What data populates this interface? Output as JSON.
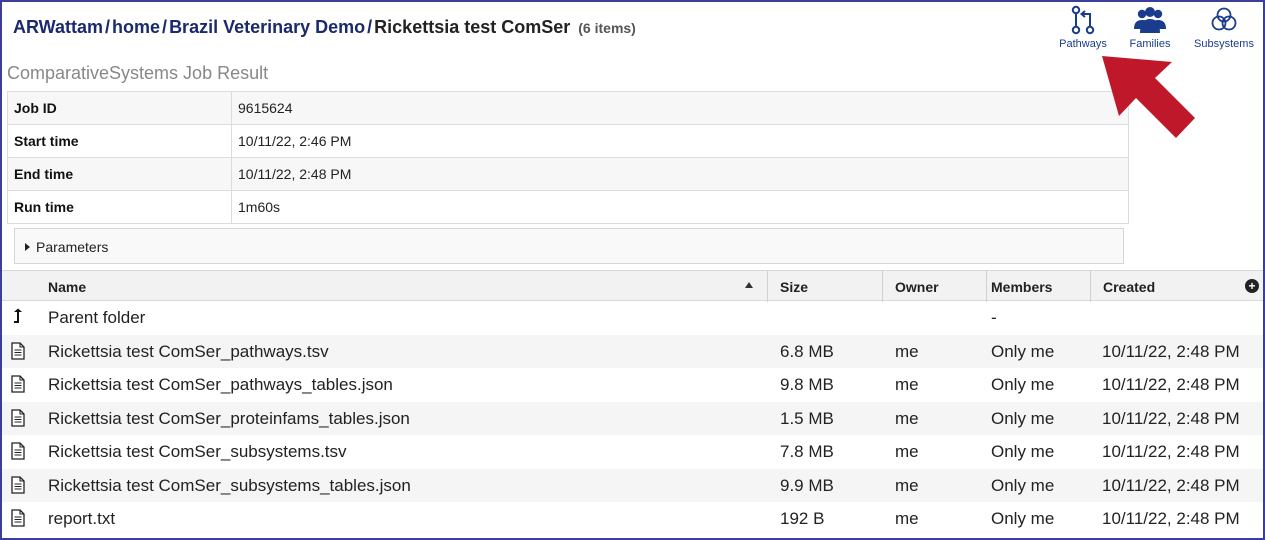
{
  "breadcrumb": {
    "items": [
      "ARWattam",
      "home",
      "Brazil Veterinary Demo"
    ],
    "current": "Rickettsia test ComSer",
    "count": "(6 items)"
  },
  "actions": [
    {
      "label": "Pathways",
      "icon": "pathways-icon"
    },
    {
      "label": "Families",
      "icon": "families-icon"
    },
    {
      "label": "Subsystems",
      "icon": "subsystems-icon"
    }
  ],
  "job": {
    "title": "ComparativeSystems Job Result",
    "rows": [
      {
        "key": "Job ID",
        "value": "9615624"
      },
      {
        "key": "Start time",
        "value": "10/11/22, 2:46 PM"
      },
      {
        "key": "End time",
        "value": "10/11/22, 2:48 PM"
      },
      {
        "key": "Run time",
        "value": "1m60s"
      }
    ],
    "parameters_label": "Parameters"
  },
  "grid": {
    "columns": {
      "name": "Name",
      "size": "Size",
      "owner": "Owner",
      "members": "Members",
      "created": "Created"
    },
    "parent": {
      "name": "Parent folder",
      "members": "-"
    },
    "rows": [
      {
        "name": "Rickettsia test ComSer_pathways.tsv",
        "size": "6.8 MB",
        "owner": "me",
        "members": "Only me",
        "created": "10/11/22, 2:48 PM"
      },
      {
        "name": "Rickettsia test ComSer_pathways_tables.json",
        "size": "9.8 MB",
        "owner": "me",
        "members": "Only me",
        "created": "10/11/22, 2:48 PM"
      },
      {
        "name": "Rickettsia test ComSer_proteinfams_tables.json",
        "size": "1.5 MB",
        "owner": "me",
        "members": "Only me",
        "created": "10/11/22, 2:48 PM"
      },
      {
        "name": "Rickettsia test ComSer_subsystems.tsv",
        "size": "7.8 MB",
        "owner": "me",
        "members": "Only me",
        "created": "10/11/22, 2:48 PM"
      },
      {
        "name": "Rickettsia test ComSer_subsystems_tables.json",
        "size": "9.9 MB",
        "owner": "me",
        "members": "Only me",
        "created": "10/11/22, 2:48 PM"
      },
      {
        "name": "report.txt",
        "size": "192 B",
        "owner": "me",
        "members": "Only me",
        "created": "10/11/22, 2:48 PM"
      }
    ]
  },
  "colors": {
    "accent": "#1a2a6c",
    "frame": "#3b3f99",
    "arrow": "#c0182b"
  }
}
